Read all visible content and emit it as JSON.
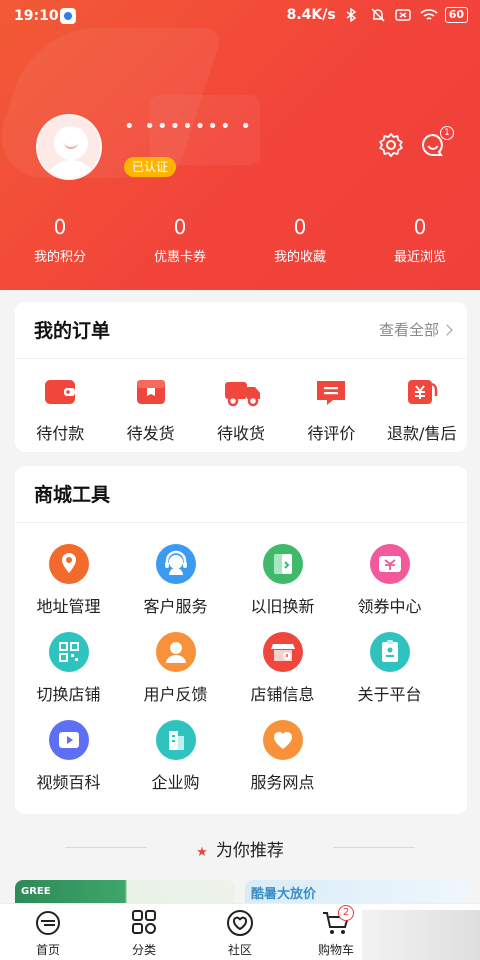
{
  "status_bar": {
    "time": "19:10",
    "net_speed": "8.4K/s",
    "battery": "60"
  },
  "profile": {
    "username": "• ••••••• •",
    "verified_label": "已认证",
    "message_badge": "1"
  },
  "stats": [
    {
      "value": "0",
      "label": "我的积分"
    },
    {
      "value": "0",
      "label": "优惠卡券"
    },
    {
      "value": "0",
      "label": "我的收藏"
    },
    {
      "value": "0",
      "label": "最近浏览"
    }
  ],
  "orders": {
    "title": "我的订单",
    "see_all": "查看全部",
    "items": [
      {
        "label": "待付款",
        "icon": "wallet-icon"
      },
      {
        "label": "待发货",
        "icon": "package-icon"
      },
      {
        "label": "待收货",
        "icon": "truck-icon"
      },
      {
        "label": "待评价",
        "icon": "comment-icon"
      },
      {
        "label": "退款/售后",
        "icon": "refund-icon"
      }
    ]
  },
  "tools": {
    "title": "商城工具",
    "items": [
      {
        "label": "地址管理",
        "icon": "location-icon",
        "color": "#f26b2c"
      },
      {
        "label": "客户服务",
        "icon": "headset-icon",
        "color": "#3a9bf0"
      },
      {
        "label": "以旧换新",
        "icon": "exchange-icon",
        "color": "#3fb96a"
      },
      {
        "label": "领券中心",
        "icon": "coupon-icon",
        "color": "#f35a9b"
      },
      {
        "label": "切换店铺",
        "icon": "qrcode-icon",
        "color": "#2fc3c0"
      },
      {
        "label": "用户反馈",
        "icon": "user-icon",
        "color": "#f7923a"
      },
      {
        "label": "店铺信息",
        "icon": "store-icon",
        "color": "#f0473c"
      },
      {
        "label": "关于平台",
        "icon": "badge-icon",
        "color": "#2fc3c0"
      },
      {
        "label": "视频百科",
        "icon": "video-icon",
        "color": "#5d6ff2"
      },
      {
        "label": "企业购",
        "icon": "building-icon",
        "color": "#2fc3c0"
      },
      {
        "label": "服务网点",
        "icon": "heart-icon",
        "color": "#f7923a"
      }
    ]
  },
  "recommend": {
    "title": "为你推荐"
  },
  "banners": [
    {
      "text": "GREE"
    },
    {
      "text": "酷暑大放价"
    }
  ],
  "tabbar": {
    "items": [
      {
        "label": "首页",
        "icon": "home-icon"
      },
      {
        "label": "分类",
        "icon": "category-icon"
      },
      {
        "label": "社区",
        "icon": "community-icon"
      },
      {
        "label": "购物车",
        "icon": "cart-icon",
        "badge": "2"
      }
    ]
  }
}
